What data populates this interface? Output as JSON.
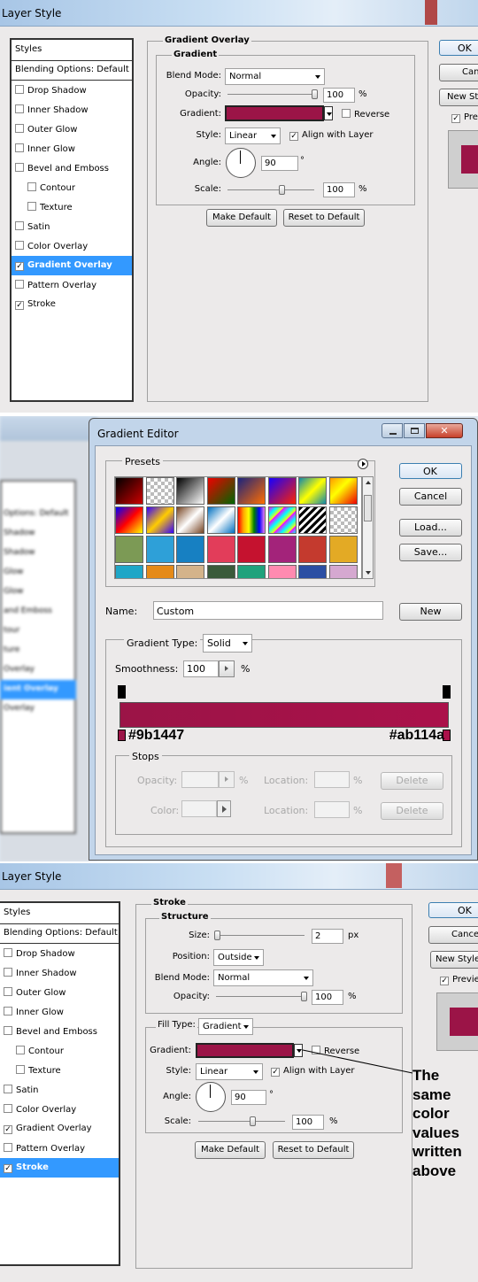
{
  "layer_style_1": {
    "title": "Layer Style",
    "styles_header": "Styles",
    "blending_options": "Blending Options: Default",
    "items": [
      {
        "label": "Drop Shadow",
        "checked": false
      },
      {
        "label": "Inner Shadow",
        "checked": false
      },
      {
        "label": "Outer Glow",
        "checked": false
      },
      {
        "label": "Inner Glow",
        "checked": false
      },
      {
        "label": "Bevel and Emboss",
        "checked": false
      },
      {
        "label": "Contour",
        "checked": false
      },
      {
        "label": "Texture",
        "checked": false
      },
      {
        "label": "Satin",
        "checked": false
      },
      {
        "label": "Color Overlay",
        "checked": false
      },
      {
        "label": "Gradient Overlay",
        "checked": true
      },
      {
        "label": "Pattern Overlay",
        "checked": false
      },
      {
        "label": "Stroke",
        "checked": true
      }
    ],
    "section_title": "Gradient Overlay",
    "group_title": "Gradient",
    "blend_mode_label": "Blend Mode:",
    "blend_mode_value": "Normal",
    "opacity_label": "Opacity:",
    "opacity_value": "100",
    "pct": "%",
    "gradient_label": "Gradient:",
    "reverse_label": "Reverse",
    "style_label": "Style:",
    "style_value": "Linear",
    "align_label": "Align with Layer",
    "angle_label": "Angle:",
    "angle_value": "90",
    "deg": "°",
    "scale_label": "Scale:",
    "scale_value": "100",
    "make_default": "Make Default",
    "reset_default": "Reset to Default",
    "ok": "OK",
    "cancel": "Cancel",
    "new_style": "New Style...",
    "preview": "Preview"
  },
  "gradient_editor": {
    "title": "Gradient Editor",
    "presets_label": "Presets",
    "ok": "OK",
    "cancel": "Cancel",
    "load": "Load...",
    "save": "Save...",
    "name_label": "Name:",
    "name_value": "Custom",
    "new": "New",
    "gradient_type_label": "Gradient Type:",
    "gradient_type_value": "Solid",
    "smoothness_label": "Smoothness:",
    "smoothness_value": "100",
    "pct": "%",
    "left_color": "#9b1447",
    "right_color": "#ab114a",
    "stops_label": "Stops",
    "opacity_label": "Opacity:",
    "color_label": "Color:",
    "location_label": "Location:",
    "delete": "Delete",
    "bg_items": [
      "Options: Default",
      "Shadow",
      "Shadow",
      "Glow",
      "Glow",
      "and Emboss",
      "tour",
      "ture",
      "Overlay",
      "ient Overlay",
      "Overlay"
    ]
  },
  "layer_style_2": {
    "title": "Layer Style",
    "styles_header": "Styles",
    "blending_options": "Blending Options: Default",
    "items": [
      {
        "label": "Drop Shadow",
        "checked": false
      },
      {
        "label": "Inner Shadow",
        "checked": false
      },
      {
        "label": "Outer Glow",
        "checked": false
      },
      {
        "label": "Inner Glow",
        "checked": false
      },
      {
        "label": "Bevel and Emboss",
        "checked": false
      },
      {
        "label": "Contour",
        "checked": false
      },
      {
        "label": "Texture",
        "checked": false
      },
      {
        "label": "Satin",
        "checked": false
      },
      {
        "label": "Color Overlay",
        "checked": false
      },
      {
        "label": "Gradient Overlay",
        "checked": true
      },
      {
        "label": "Pattern Overlay",
        "checked": false
      },
      {
        "label": "Stroke",
        "checked": true
      }
    ],
    "section_title": "Stroke",
    "group_title": "Structure",
    "size_label": "Size:",
    "size_value": "2",
    "px": "px",
    "position_label": "Position:",
    "position_value": "Outside",
    "blend_mode_label": "Blend Mode:",
    "blend_mode_value": "Normal",
    "opacity_label": "Opacity:",
    "opacity_value": "100",
    "pct": "%",
    "fill_type_label": "Fill Type:",
    "fill_type_value": "Gradient",
    "gradient_label": "Gradient:",
    "reverse_label": "Reverse",
    "style_label": "Style:",
    "style_value": "Linear",
    "align_label": "Align with Layer",
    "angle_label": "Angle:",
    "angle_value": "90",
    "deg": "°",
    "scale_label": "Scale:",
    "scale_value": "100",
    "make_default": "Make Default",
    "reset_default": "Reset to Default",
    "ok": "OK",
    "cancel": "Cancel",
    "new_style": "New Style...",
    "preview": "Preview"
  },
  "annotation": [
    "The",
    "same",
    "color",
    "values",
    "written",
    "above"
  ],
  "colors": {
    "gradient_left": "#9b1447",
    "gradient_right": "#ab114a",
    "selection": "#3399ff"
  }
}
